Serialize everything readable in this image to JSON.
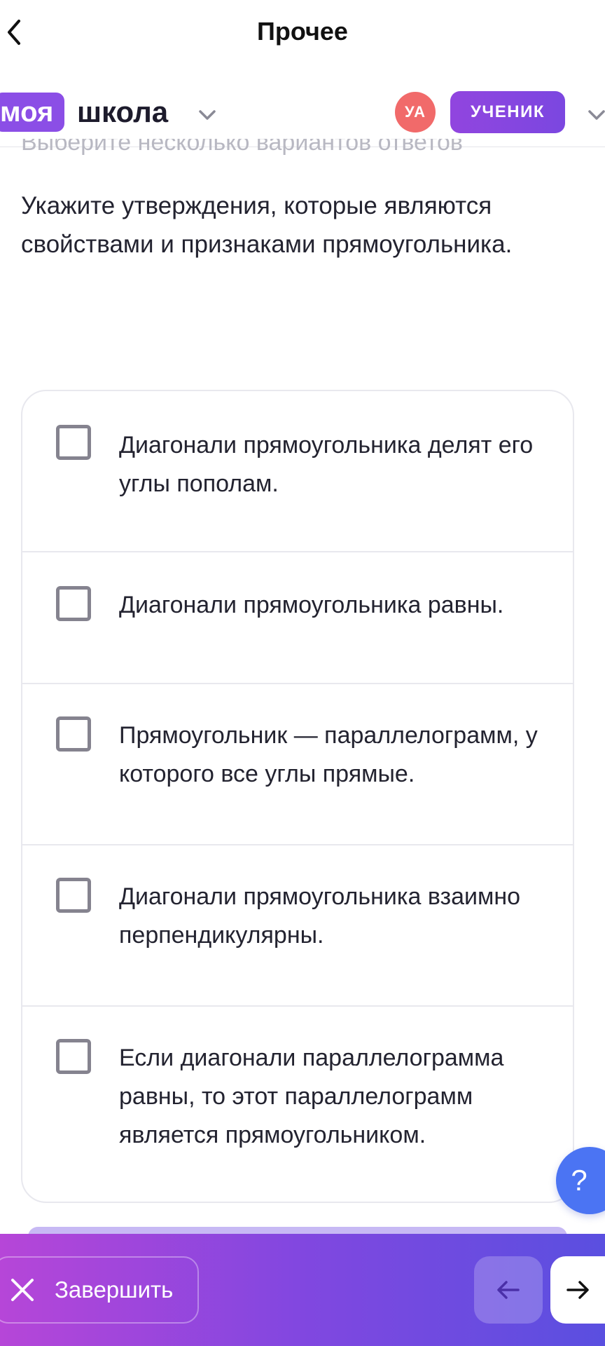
{
  "header": {
    "title": "Прочее"
  },
  "school": {
    "logo_highlight": "моя",
    "logo_word": "школа",
    "avatar_initials": "УА",
    "role": "УЧЕНИК"
  },
  "instruction": "Выберите несколько вариантов ответов",
  "question": "Укажите утверждения, которые являются свойствами и признаками прямоугольника.",
  "options": [
    {
      "text": "Диагонали прямоугольника делят его углы пополам.",
      "checked": false
    },
    {
      "text": "Диагонали прямоугольника равны.",
      "checked": false
    },
    {
      "text": "Прямоугольник — параллелограмм, у которого все углы прямые.",
      "checked": false
    },
    {
      "text": "Диагонали прямоугольника взаимно перпендикулярны.",
      "checked": false
    },
    {
      "text": "Если диагонали параллелограмма равны, то этот параллелограмм является прямоугольником.",
      "checked": false
    }
  ],
  "help": {
    "label": "?"
  },
  "footer": {
    "finish_label": "Завершить"
  },
  "colors": {
    "accent": "#8b4ee6",
    "avatar": "#f16a6a",
    "help_fab": "#4b74f3",
    "bar_start": "#b646d8",
    "bar_end": "#5a4fe0"
  }
}
